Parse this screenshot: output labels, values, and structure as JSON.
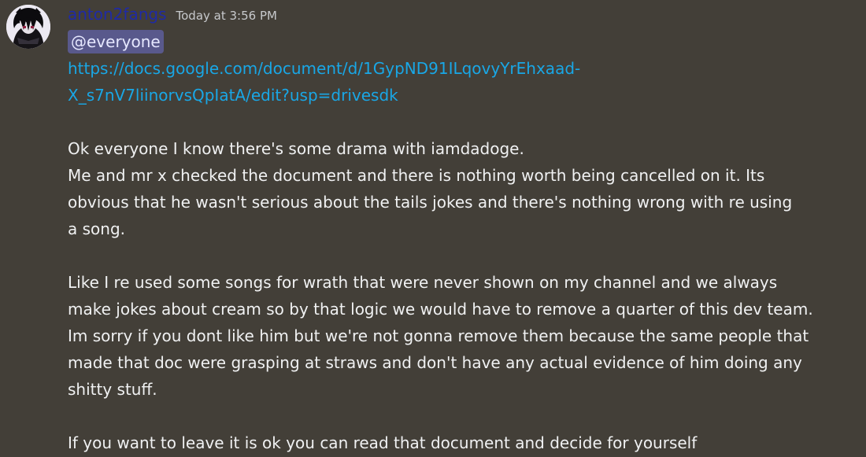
{
  "message": {
    "author": "anton2fangs",
    "timestamp": "Today at 3:56 PM",
    "mention": "@everyone",
    "link_line1": "https://docs.google.com/document/d/1GypND91ILqovyYrEhxaad-",
    "link_line2": "X_s7nV7liinorvsQpIatA/edit?usp=drivesdk",
    "lines": [
      "Ok everyone I know there's some drama with iamdadoge.",
      "Me and mr x checked the document and there is nothing worth being cancelled on it. Its",
      "obvious that he wasn't serious about the tails jokes and there's nothing wrong with re using",
      "a song.",
      "Like I re used some songs for wrath that were never shown on my channel and we always",
      "make jokes about cream so by that logic we would have to remove a quarter of this dev team.",
      "Im sorry if you dont like him but we're not gonna remove them because the same people that",
      "made that doc were grasping at straws and don't have any actual evidence of him doing any",
      "shitty stuff.",
      "If you want to leave it is ok you can read that document and decide for yourself"
    ]
  },
  "colors": {
    "background": "#433f38",
    "username": "#1f2aa6",
    "link": "#19a7e6",
    "mention_bg": "#59598c"
  }
}
